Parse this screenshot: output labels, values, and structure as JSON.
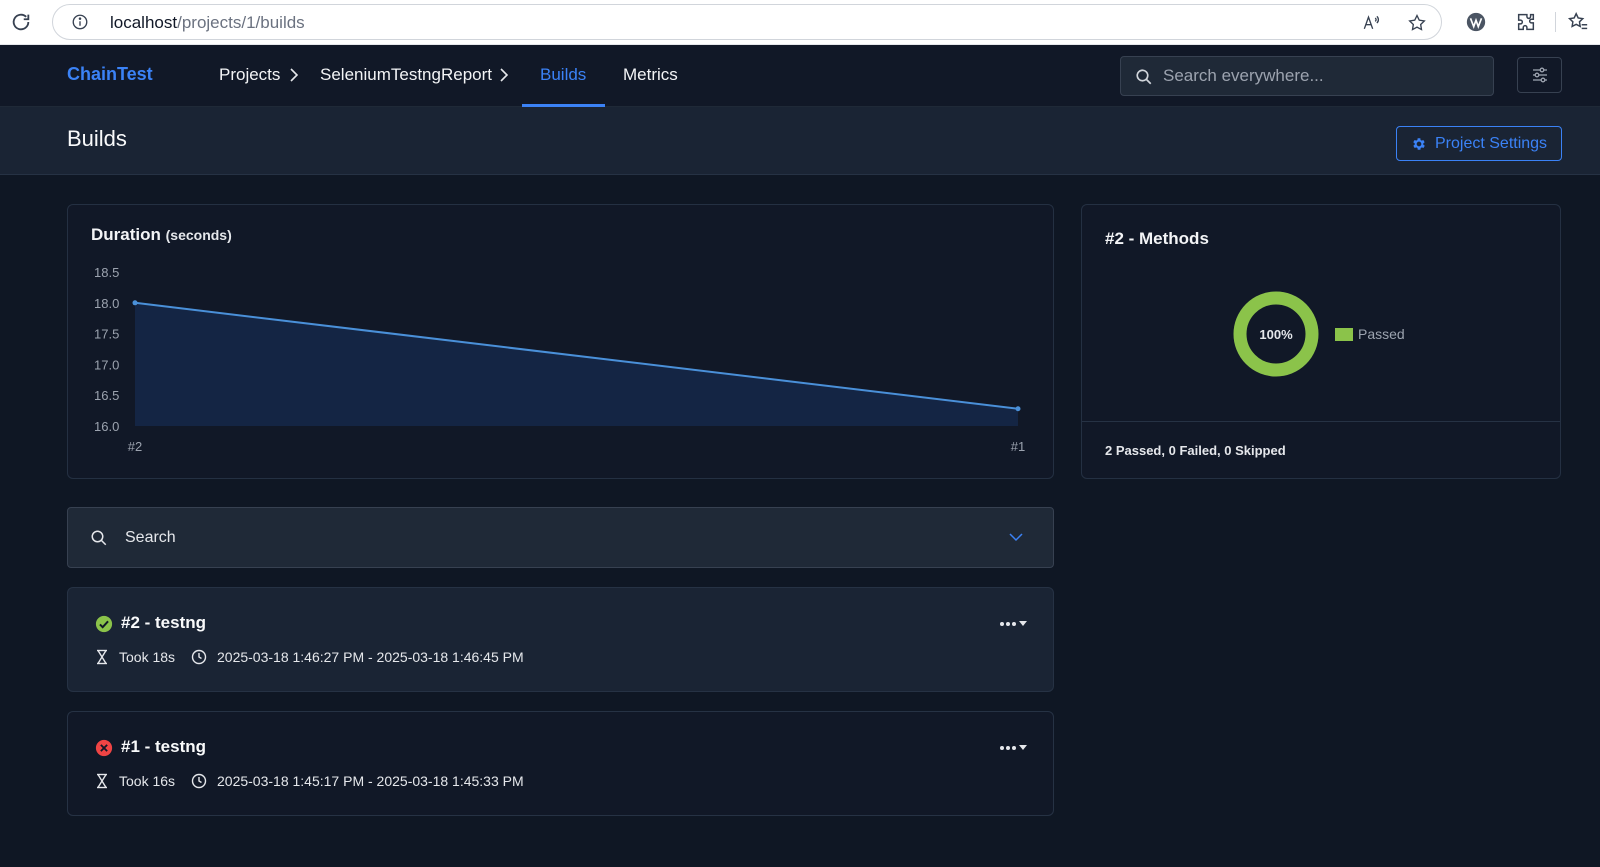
{
  "browser": {
    "url_host": "localhost",
    "url_path": "/projects/1/builds"
  },
  "nav": {
    "brand": "ChainTest",
    "breadcrumbs": [
      "Projects",
      "SeleniumTestngReport"
    ],
    "tabs": [
      {
        "label": "Builds",
        "active": true
      },
      {
        "label": "Metrics",
        "active": false
      }
    ],
    "search_placeholder": "Search everywhere..."
  },
  "header": {
    "title": "Builds",
    "settings_label": "Project Settings"
  },
  "duration_chart": {
    "title": "Duration",
    "subtitle": "(seconds)"
  },
  "chart_data": {
    "type": "area",
    "categories": [
      "#2",
      "#1"
    ],
    "values": [
      18.0,
      16.28
    ],
    "ylim": [
      16.0,
      18.5
    ],
    "yticks": [
      "18.5",
      "18.0",
      "17.5",
      "17.0",
      "16.5",
      "16.0"
    ],
    "grid": false,
    "line_color": "#4a90d9",
    "fill_color": "#142544"
  },
  "methods": {
    "title": "#2 - Methods",
    "center_label": "100%",
    "legend_label": "Passed",
    "passed_fraction": 1.0,
    "passed_color": "#8bc34a",
    "summary": "2 Passed, 0 Failed, 0 Skipped"
  },
  "build_search": {
    "label": "Search"
  },
  "builds": [
    {
      "title": "#2 - testng",
      "status": "passed",
      "took": "Took 18s",
      "range": "2025-03-18 1:46:27 PM - 2025-03-18 1:46:45 PM"
    },
    {
      "title": "#1 - testng",
      "status": "failed",
      "took": "Took 16s",
      "range": "2025-03-18 1:45:17 PM - 2025-03-18 1:45:33 PM"
    }
  ],
  "colors": {
    "accent": "#3b82f6",
    "pass": "#8bc34a",
    "fail": "#ef4444"
  }
}
